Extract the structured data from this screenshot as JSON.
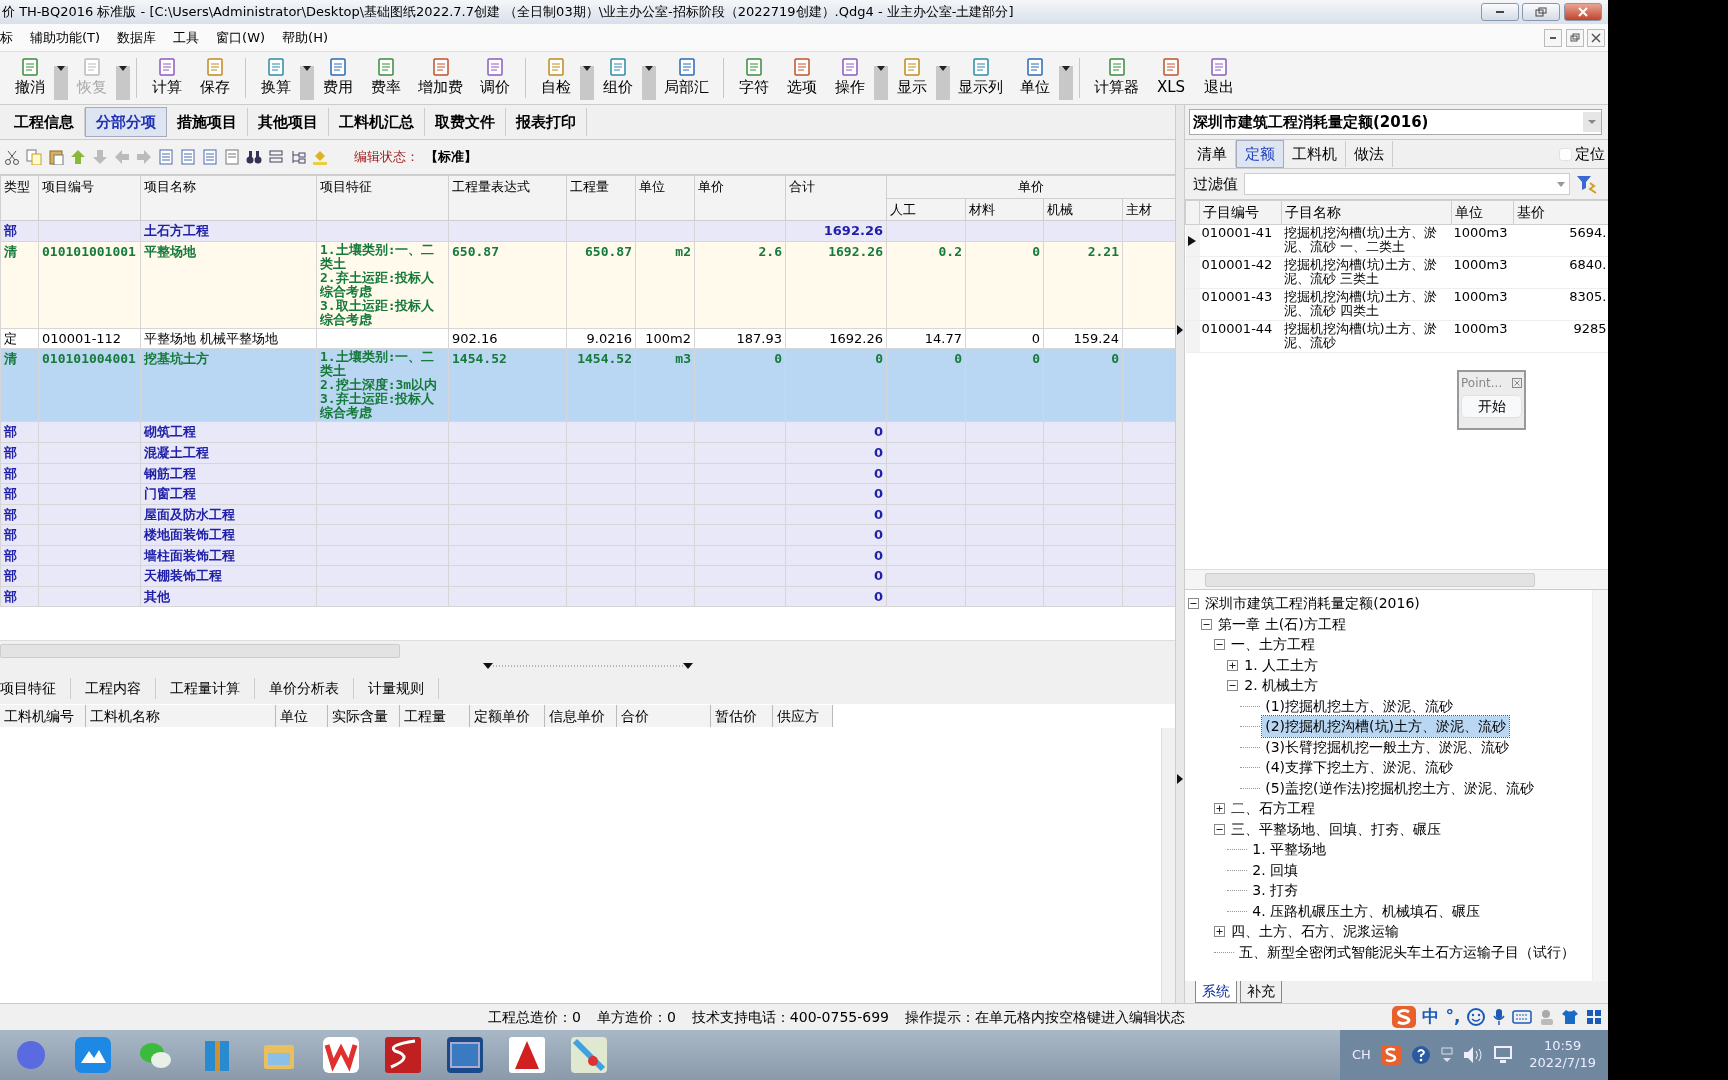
{
  "window": {
    "title": "价 TH-BQ2016 标准版 - [C:\\Users\\Administrator\\Desktop\\基础图纸2022.7.7创建 （全日制03期）\\业主办公室-招标阶段（2022719创建）.Qdg4 - 业主办公室-土建部分]"
  },
  "menu": [
    "标",
    "辅助功能(T)",
    "数据库",
    "工具",
    "窗口(W)",
    "帮助(H)"
  ],
  "toolbar": [
    [
      {
        "label": "撤消",
        "kind": "split",
        "disabled": false
      },
      {
        "label": "恢复",
        "kind": "split",
        "disabled": true
      }
    ],
    [
      {
        "label": "计算",
        "kind": "plain",
        "disabled": false
      },
      {
        "label": "保存",
        "kind": "plain",
        "disabled": false
      }
    ],
    [
      {
        "label": "换算",
        "kind": "split",
        "disabled": false
      },
      {
        "label": "费用",
        "kind": "plain",
        "disabled": false
      },
      {
        "label": "费率",
        "kind": "plain",
        "disabled": false
      },
      {
        "label": "增加费",
        "kind": "plain",
        "disabled": false
      },
      {
        "label": "调价",
        "kind": "plain",
        "disabled": false
      }
    ],
    [
      {
        "label": "自检",
        "kind": "split",
        "disabled": false
      },
      {
        "label": "组价",
        "kind": "split",
        "disabled": false
      },
      {
        "label": "局部汇",
        "kind": "plain",
        "disabled": false
      }
    ],
    [
      {
        "label": "字符",
        "kind": "plain",
        "disabled": false
      },
      {
        "label": "选项",
        "kind": "plain",
        "disabled": false
      },
      {
        "label": "操作",
        "kind": "split",
        "disabled": false
      },
      {
        "label": "显示",
        "kind": "split",
        "disabled": false
      },
      {
        "label": "显示列",
        "kind": "plain",
        "disabled": false
      },
      {
        "label": "单位",
        "kind": "split",
        "disabled": false
      }
    ],
    [
      {
        "label": "计算器",
        "kind": "plain",
        "disabled": false
      },
      {
        "label": "XLS",
        "kind": "plain",
        "disabled": false
      },
      {
        "label": "退出",
        "kind": "plain",
        "disabled": false
      }
    ]
  ],
  "tabs": [
    {
      "label": "工程信息",
      "selected": false
    },
    {
      "label": "分部分项",
      "selected": true
    },
    {
      "label": "措施项目",
      "selected": false
    },
    {
      "label": "其他项目",
      "selected": false
    },
    {
      "label": "工料机汇总",
      "selected": false
    },
    {
      "label": "取费文件",
      "selected": false
    },
    {
      "label": "报表打印",
      "selected": false
    }
  ],
  "edit_status": {
    "label": "编辑状态：",
    "value": "【标准】"
  },
  "table": {
    "columns": [
      "类型",
      "项目编号",
      "项目名称",
      "项目特征",
      "工程量表达式",
      "工程量",
      "单位",
      "单价",
      "合计"
    ],
    "group": {
      "label": "单价",
      "columns": [
        "人工",
        "材料",
        "机械",
        "主材"
      ]
    },
    "rows": [
      {
        "kind": "bu",
        "selected": false,
        "type": "部",
        "name": "土石方工程",
        "total": "1692.26"
      },
      {
        "kind": "qing",
        "selected": false,
        "type": "清",
        "code": "010101001001",
        "name": "平整场地",
        "features": [
          "1.土壤类别:一、二类土",
          "2.弃土运距:投标人综合考虑",
          "3.取土运距:投标人综合考虑"
        ],
        "expr": "650.87",
        "qty": "650.87",
        "unit": "m2",
        "price": "2.6",
        "total": "1692.26",
        "labor": "0.2",
        "material": "0",
        "machine": "2.21"
      },
      {
        "kind": "ding",
        "selected": false,
        "type": "定",
        "code": "010001-112",
        "name": "平整场地 机械平整场地",
        "expr": "902.16",
        "qty": "9.0216",
        "unit": "100m2",
        "price": "187.93",
        "total": "1692.26",
        "labor": "14.77",
        "material": "0",
        "machine": "159.24"
      },
      {
        "kind": "qing",
        "selected": true,
        "type": "清",
        "code": "010101004001",
        "name": "挖基坑土方",
        "features": [
          "1.土壤类别:一、二类土",
          "2.挖土深度:3m以内",
          "3.弃土运距:投标人综合考虑"
        ],
        "expr": "1454.52",
        "qty": "1454.52",
        "unit": "m3",
        "price": "0",
        "total": "0",
        "labor": "0",
        "material": "0",
        "machine": "0"
      },
      {
        "kind": "bu",
        "selected": false,
        "type": "部",
        "name": "砌筑工程",
        "total": "0"
      },
      {
        "kind": "bu",
        "selected": false,
        "type": "部",
        "name": "混凝土工程",
        "total": "0"
      },
      {
        "kind": "bu",
        "selected": false,
        "type": "部",
        "name": "钢筋工程",
        "total": "0"
      },
      {
        "kind": "bu",
        "selected": false,
        "type": "部",
        "name": "门窗工程",
        "total": "0"
      },
      {
        "kind": "bu",
        "selected": false,
        "type": "部",
        "name": "屋面及防水工程",
        "total": "0"
      },
      {
        "kind": "bu",
        "selected": false,
        "type": "部",
        "name": "楼地面装饰工程",
        "total": "0"
      },
      {
        "kind": "bu",
        "selected": false,
        "type": "部",
        "name": "墙柱面装饰工程",
        "total": "0"
      },
      {
        "kind": "bu",
        "selected": false,
        "type": "部",
        "name": "天棚装饰工程",
        "total": "0"
      },
      {
        "kind": "bu",
        "selected": false,
        "type": "部",
        "name": "其他",
        "total": "0"
      }
    ]
  },
  "bottom_tabs": [
    "项目特征",
    "工程内容",
    "工程量计算",
    "单价分析表",
    "计量规则"
  ],
  "sub_table": {
    "columns": [
      "工料机编号",
      "工料机名称",
      "单位",
      "实际含量",
      "工程量",
      "定额单价",
      "信息单价",
      "合价",
      "暂估价",
      "供应方"
    ]
  },
  "status_bar": [
    "工程总造价：0",
    "单方造价：0",
    "技术支持电话：400-0755-699",
    "操作提示：在单元格内按空格键进入编辑状态"
  ],
  "library": {
    "value": "深圳市建筑工程消耗量定额(2016)"
  },
  "right_tabs": [
    {
      "label": "清单",
      "selected": false
    },
    {
      "label": "定额",
      "selected": true
    },
    {
      "label": "工料机",
      "selected": false
    },
    {
      "label": "做法",
      "selected": false
    }
  ],
  "locate": {
    "label": "定位",
    "checked": false
  },
  "filter": {
    "label": "过滤值"
  },
  "quota_table": {
    "columns": [
      "子目编号",
      "子目名称",
      "单位",
      "基价"
    ],
    "rows": [
      {
        "current": true,
        "code": "010001-41",
        "name": "挖掘机挖沟槽(坑)土方、淤泥、流砂 一、二类土",
        "unit": "1000m3",
        "price": "5694."
      },
      {
        "current": false,
        "code": "010001-42",
        "name": "挖掘机挖沟槽(坑)土方、淤泥、流砂 三类土",
        "unit": "1000m3",
        "price": "6840."
      },
      {
        "current": false,
        "code": "010001-43",
        "name": "挖掘机挖沟槽(坑)土方、淤泥、流砂 四类土",
        "unit": "1000m3",
        "price": "8305."
      },
      {
        "current": false,
        "code": "010001-44",
        "name": "挖掘机挖沟槽(坑)土方、淤泥、流砂",
        "unit": "1000m3",
        "price": "9285"
      }
    ]
  },
  "point_dialog": {
    "title": "Point...",
    "button": "开始"
  },
  "tree": {
    "kind": "folder",
    "label": "深圳市建筑工程消耗量定额(2016)",
    "expanded": true,
    "selected": false,
    "children": [
      {
        "kind": "folder",
        "label": "第一章 土(石)方工程",
        "expanded": true,
        "selected": false,
        "children": [
          {
            "kind": "folder",
            "label": "一、土方工程",
            "expanded": true,
            "selected": false,
            "children": [
              {
                "kind": "folder",
                "label": "1. 人工土方",
                "expanded": false,
                "selected": false
              },
              {
                "kind": "folder",
                "label": "2. 机械土方",
                "expanded": true,
                "selected": false,
                "children": [
                  {
                    "kind": "leaf",
                    "label": "(1)挖掘机挖土方、淤泥、流砂",
                    "selected": false
                  },
                  {
                    "kind": "leaf",
                    "label": "(2)挖掘机挖沟槽(坑)土方、淤泥、流砂",
                    "selected": true
                  },
                  {
                    "kind": "leaf",
                    "label": "(3)长臂挖掘机挖一般土方、淤泥、流砂",
                    "selected": false
                  },
                  {
                    "kind": "leaf",
                    "label": "(4)支撑下挖土方、淤泥、流砂",
                    "selected": false
                  },
                  {
                    "kind": "leaf",
                    "label": "(5)盖挖(逆作法)挖掘机挖土方、淤泥、流砂",
                    "selected": false
                  }
                ]
              }
            ]
          },
          {
            "kind": "folder",
            "label": "二、石方工程",
            "expanded": false,
            "selected": false
          },
          {
            "kind": "folder",
            "label": "三、平整场地、回填、打夯、碾压",
            "expanded": true,
            "selected": false,
            "children": [
              {
                "kind": "leaf",
                "label": "1. 平整场地",
                "selected": false
              },
              {
                "kind": "leaf",
                "label": "2. 回填",
                "selected": false
              },
              {
                "kind": "leaf",
                "label": "3. 打夯",
                "selected": false
              },
              {
                "kind": "leaf",
                "label": "4. 压路机碾压土方、机械填石、碾压",
                "selected": false
              }
            ]
          },
          {
            "kind": "folder",
            "label": "四、土方、石方、泥浆运输",
            "expanded": false,
            "selected": false
          },
          {
            "kind": "leaf",
            "label": "五、新型全密闭式智能泥头车土石方运输子目（试行）",
            "selected": false
          }
        ]
      }
    ]
  },
  "library_tabs": [
    {
      "label": "系统",
      "selected": true
    },
    {
      "label": "补充",
      "selected": false
    }
  ],
  "ime": [
    "中",
    "°,"
  ],
  "tray": {
    "language": "CH",
    "time": "10:59",
    "date": "2022/7/19"
  }
}
